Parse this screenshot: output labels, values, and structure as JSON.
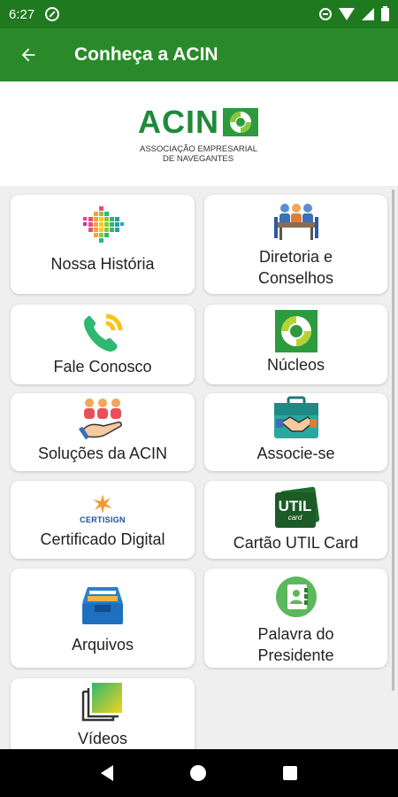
{
  "status_bar": {
    "time": "6:27"
  },
  "app_bar": {
    "title": "Conheça a ACIN"
  },
  "logo": {
    "name": "ACIN",
    "line1": "ASSOCIAÇÃO EMPRESARIAL",
    "line2": "DE NAVEGANTES"
  },
  "menu": [
    {
      "label": "Nossa História",
      "icon": "history-dots-icon"
    },
    {
      "label": "Diretoria e Conselhos",
      "icon": "board-meeting-icon"
    },
    {
      "label": "Fale Conosco",
      "icon": "phone-call-icon"
    },
    {
      "label": "Núcleos",
      "icon": "nucleos-logo-icon"
    },
    {
      "label": "Soluções da ACIN",
      "icon": "people-hand-icon"
    },
    {
      "label": "Associe-se",
      "icon": "handshake-briefcase-icon"
    },
    {
      "label": "Certificado Digital",
      "icon": "certisign-icon",
      "icon_text": "CERTISIGN"
    },
    {
      "label": "Cartão UTIL Card",
      "icon": "util-card-icon",
      "icon_text": "UTIL",
      "icon_subtext": "card"
    },
    {
      "label": "Arquivos",
      "icon": "archive-box-icon"
    },
    {
      "label": "Palavra do Presidente",
      "icon": "contact-book-icon"
    },
    {
      "label": "Vídeos",
      "icon": "video-gallery-icon"
    }
  ],
  "colors": {
    "status_bar": "#1f7a1f",
    "app_bar": "#2a8a2a",
    "brand_green": "#1f8a3a",
    "background": "#efefef"
  }
}
